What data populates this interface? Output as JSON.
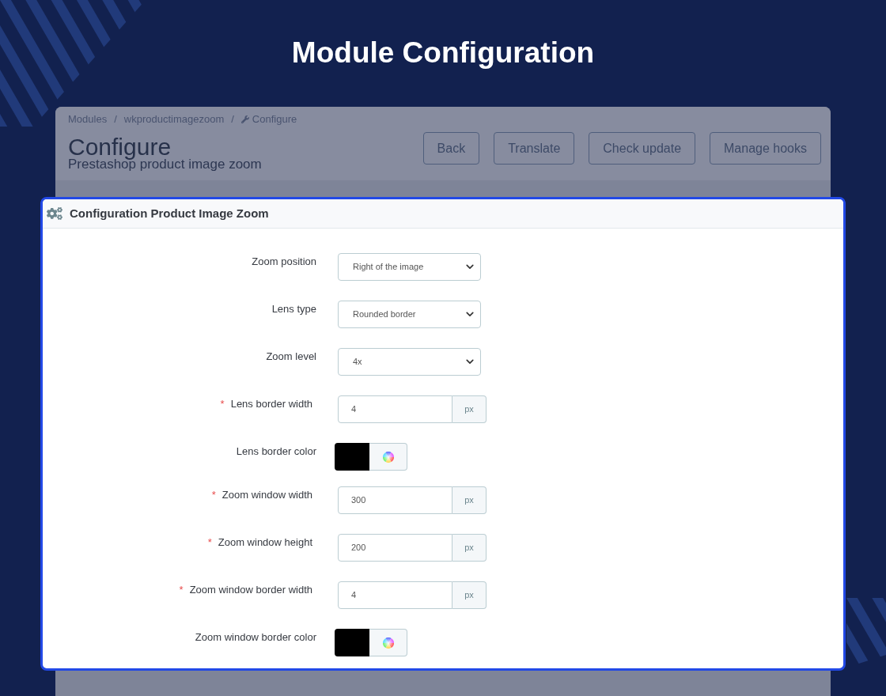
{
  "page_title": "Module Configuration",
  "breadcrumb": [
    {
      "label": "Modules",
      "separator": "/"
    },
    {
      "label": "wkproductimagezoom",
      "separator": "/"
    },
    {
      "label": "Configure"
    }
  ],
  "header": {
    "title": "Configure",
    "subtitle": "Prestashop product image zoom",
    "buttons": [
      "Back",
      "Translate",
      "Check update",
      "Manage hooks"
    ]
  },
  "panel": {
    "title": "Configuration Product Image Zoom",
    "fields": [
      {
        "kind": "select",
        "label": "Zoom position",
        "value": "Right of the image"
      },
      {
        "kind": "select",
        "label": "Lens type",
        "value": "Rounded border"
      },
      {
        "kind": "select",
        "label": "Zoom level",
        "value": "4x"
      },
      {
        "kind": "number",
        "label": "Lens border width",
        "mark": "*",
        "value": "4",
        "unit": "px"
      },
      {
        "kind": "color",
        "label": "Lens border color",
        "color": "#000000"
      },
      {
        "kind": "number",
        "label": "Zoom window width",
        "mark": "*",
        "value": "300",
        "unit": "px"
      },
      {
        "kind": "number",
        "label": "Zoom window height",
        "mark": "*",
        "value": "200",
        "unit": "px"
      },
      {
        "kind": "number",
        "label": "Zoom window border width",
        "mark": "*",
        "value": "4",
        "unit": "px"
      },
      {
        "kind": "color",
        "label": "Zoom window border color",
        "color": "#000000"
      }
    ]
  }
}
